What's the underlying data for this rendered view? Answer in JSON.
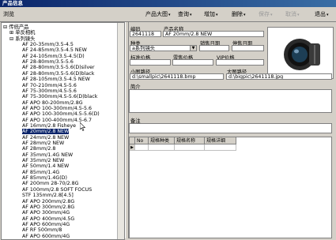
{
  "window": {
    "title": "产品信息"
  },
  "toolbar": {
    "left_label": "浏览",
    "buttons": [
      {
        "label": "产品大图",
        "enabled": true,
        "has_menu": true
      },
      {
        "label": "查询",
        "enabled": true,
        "has_menu": true
      },
      {
        "label": "增加",
        "enabled": true,
        "has_menu": true
      },
      {
        "label": "删除",
        "enabled": true,
        "has_menu": true
      },
      {
        "label": "保存",
        "enabled": false,
        "has_menu": true
      },
      {
        "label": "取消",
        "enabled": false,
        "has_menu": true
      },
      {
        "label": "退出",
        "enabled": true,
        "has_menu": true
      }
    ]
  },
  "tree": {
    "nodes": [
      {
        "label": "传统产品",
        "level": 0,
        "prefix": "⊟",
        "selected": false
      },
      {
        "label": "单反相机",
        "level": 1,
        "prefix": "⊞",
        "selected": false
      },
      {
        "label": "系列镜头",
        "level": 1,
        "prefix": "⊟",
        "selected": false
      },
      {
        "label": "AF 20-35mm/3.5-4.5",
        "level": 2,
        "prefix": "",
        "selected": false
      },
      {
        "label": "AF 24-85mm/3.5-4.5 NEW",
        "level": 2,
        "prefix": "",
        "selected": false
      },
      {
        "label": "AF 24-105mm/3.5-4.5(D)",
        "level": 2,
        "prefix": "",
        "selected": false
      },
      {
        "label": "AF 28-80mm/3.5-5.6",
        "level": 2,
        "prefix": "",
        "selected": false
      },
      {
        "label": "AF 28-80mm/3.5-5.6(D)silver",
        "level": 2,
        "prefix": "",
        "selected": false
      },
      {
        "label": "AF 28-80mm/3.5-5.6(D)black",
        "level": 2,
        "prefix": "",
        "selected": false
      },
      {
        "label": "AF 28-105mm/3.5-4.5 NEW",
        "level": 2,
        "prefix": "",
        "selected": false
      },
      {
        "label": "AF 70-210mm/4.5-5.6",
        "level": 2,
        "prefix": "",
        "selected": false
      },
      {
        "label": "AF 75-300mm/4.5-5.6",
        "level": 2,
        "prefix": "",
        "selected": false
      },
      {
        "label": "AF 75-300mm/4.5-5.6(D)black",
        "level": 2,
        "prefix": "",
        "selected": false
      },
      {
        "label": "AF APO 80-200mm/2.8G",
        "level": 2,
        "prefix": "",
        "selected": false
      },
      {
        "label": "AF APO 100-300mm/4.5-5.6",
        "level": 2,
        "prefix": "",
        "selected": false
      },
      {
        "label": "AF APO 100-300mm/4.5-5.6(D)",
        "level": 2,
        "prefix": "",
        "selected": false
      },
      {
        "label": "AF APO 100-400mm/4.5-6.7",
        "level": 2,
        "prefix": "",
        "selected": false
      },
      {
        "label": "AF 16mm/2.8 Fisheye",
        "level": 2,
        "prefix": "",
        "selected": false
      },
      {
        "label": "AF 20mm/2.8 NEW",
        "level": 2,
        "prefix": "",
        "selected": true
      },
      {
        "label": "AF 24mm/2.8 NEW",
        "level": 2,
        "prefix": "",
        "selected": false
      },
      {
        "label": "AF 28mm/2 NEW",
        "level": 2,
        "prefix": "",
        "selected": false
      },
      {
        "label": "AF 28mm/2.8",
        "level": 2,
        "prefix": "",
        "selected": false
      },
      {
        "label": "AF 35mm/1.4G NEW",
        "level": 2,
        "prefix": "",
        "selected": false
      },
      {
        "label": "AF 35mm/2 NEW",
        "level": 2,
        "prefix": "",
        "selected": false
      },
      {
        "label": "AF 50mm/1.4 NEW",
        "level": 2,
        "prefix": "",
        "selected": false
      },
      {
        "label": "AF 85mm/1.4G",
        "level": 2,
        "prefix": "",
        "selected": false
      },
      {
        "label": "AF 85mm/1.4G(D)",
        "level": 2,
        "prefix": "",
        "selected": false
      },
      {
        "label": "AF 200mm 28-70/2.8G",
        "level": 2,
        "prefix": "",
        "selected": false
      },
      {
        "label": "AF 100mm/2.8 SOFT FOCUS",
        "level": 2,
        "prefix": "",
        "selected": false
      },
      {
        "label": "STF 135mm/2.8[4.5]",
        "level": 2,
        "prefix": "",
        "selected": false
      },
      {
        "label": "AF APO 200mm/2.8G",
        "level": 2,
        "prefix": "",
        "selected": false
      },
      {
        "label": "AF APO 300mm/2.8G",
        "level": 2,
        "prefix": "",
        "selected": false
      },
      {
        "label": "AF APO 300mm/4G",
        "level": 2,
        "prefix": "",
        "selected": false
      },
      {
        "label": "AF APO 400mm/4.5G",
        "level": 2,
        "prefix": "",
        "selected": false
      },
      {
        "label": "AF APO 600mm/4G",
        "level": 2,
        "prefix": "",
        "selected": false
      },
      {
        "label": "AF RF 500mm/8",
        "level": 2,
        "prefix": "",
        "selected": false
      },
      {
        "label": "AF APO 600mm/4G",
        "level": 2,
        "prefix": "",
        "selected": false
      }
    ]
  },
  "form": {
    "code_label": "编码",
    "code_value": "2641118",
    "name_label": "产品名称",
    "name_value": "AF 20mm/2.8 NEW",
    "category_label": "种类",
    "category_value": "a系列镜头",
    "sale_date_label": "销售日期",
    "sale_date_value": "",
    "stop_date_label": "停售日期",
    "stop_date_value": "",
    "std_price_label": "标准价格",
    "std_price_value": "",
    "retail_price_label": "零售价格",
    "retail_price_value": "",
    "vip_price_label": "VIP价格",
    "vip_price_value": "",
    "small_path_label": "小图路径",
    "small_path_value": "d:\\smallpic\\2641118.bmp",
    "large_path_label": "大图路径",
    "large_path_value": "d:\\bigpic\\2641118.jpg",
    "intro_label": "简介",
    "remarks_label": "备注"
  },
  "grid": {
    "columns": [
      "No",
      "规格种类",
      "规格名称",
      "规格详细"
    ]
  },
  "icons": {
    "dropdown": "chevron-down-icon",
    "lens": "lens-photo",
    "cursor": "mouse-cursor-icon"
  }
}
